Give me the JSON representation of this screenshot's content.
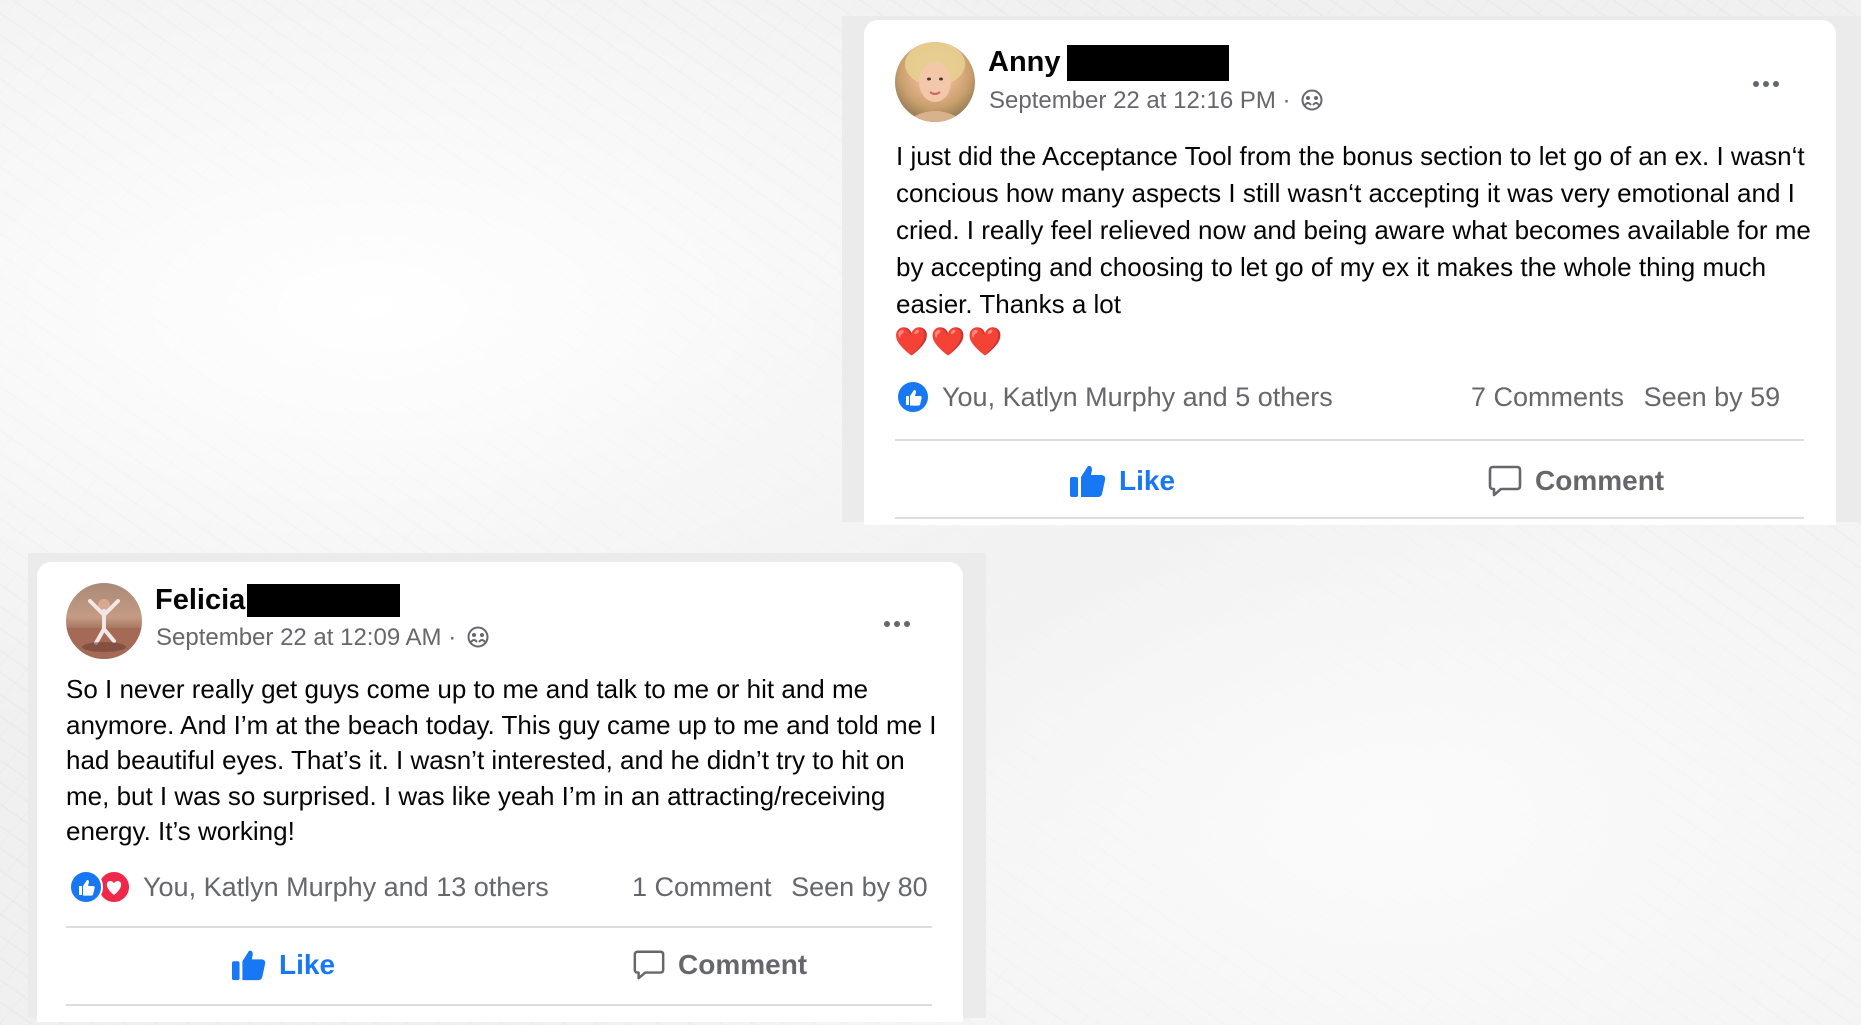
{
  "posts": [
    {
      "author": "Anny",
      "timestamp": "September 22 at 12:16 PM",
      "separator": "·",
      "text": "I just did the Acceptance Tool from the bonus section to let go of an ex. I wasn‘t concious how many aspects I still wasn‘t accepting it was very emotional and I cried. I really feel relieved now and being aware what becomes available for me by accepting and choosing to let go of my ex it makes the whole thing much easier. Thanks a lot",
      "emojis": "❤️❤️❤️",
      "reactions_text": "You, Katlyn Murphy and 5 others",
      "comments_text": "7 Comments",
      "seen_text": "Seen by 59",
      "like_label": "Like",
      "comment_label": "Comment"
    },
    {
      "author": "Felicia",
      "timestamp": "September 22 at 12:09 AM",
      "separator": "·",
      "text": "So I never really get guys come up to me and talk to me or hit and me anymore. And I’m at the beach today. This guy came up to me and told me I had beautiful eyes. That’s it. I wasn’t interested, and he didn’t try to hit on me, but I was so surprised. I was like yeah I’m in an attracting/receiving energy. It’s working!",
      "reactions_text": "You, Katlyn Murphy and 13 others",
      "comments_text": "1 Comment",
      "seen_text": "Seen by 80",
      "like_label": "Like",
      "comment_label": "Comment"
    }
  ],
  "colors": {
    "facebook_blue": "#1877f2",
    "love_red": "#f02849",
    "meta_gray": "#65676b"
  },
  "icons": [
    "more-options-icon",
    "group-privacy-icon",
    "like-reaction-icon",
    "love-reaction-icon",
    "thumbs-up-icon",
    "comment-bubble-icon"
  ]
}
